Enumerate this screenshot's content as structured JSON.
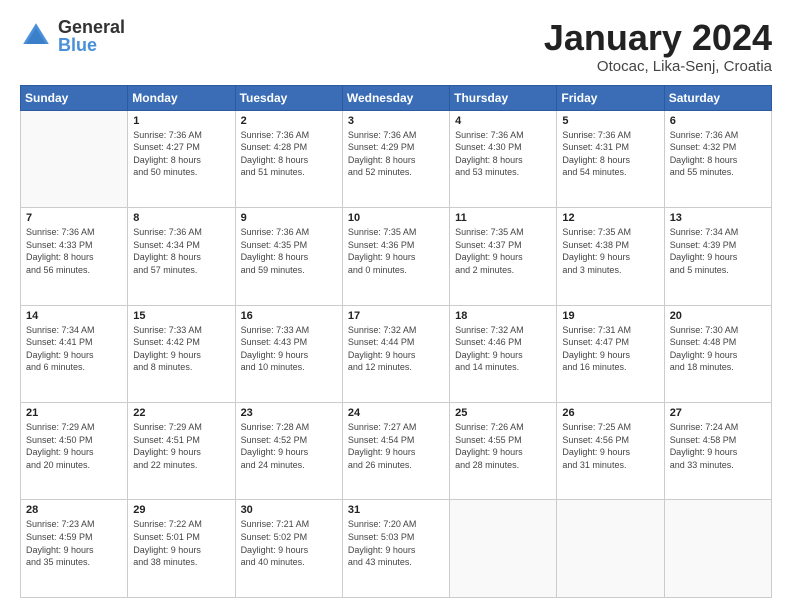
{
  "logo": {
    "general": "General",
    "blue": "Blue"
  },
  "header": {
    "month": "January 2024",
    "location": "Otocac, Lika-Senj, Croatia"
  },
  "days_of_week": [
    "Sunday",
    "Monday",
    "Tuesday",
    "Wednesday",
    "Thursday",
    "Friday",
    "Saturday"
  ],
  "weeks": [
    [
      {
        "day": "",
        "info": ""
      },
      {
        "day": "1",
        "info": "Sunrise: 7:36 AM\nSunset: 4:27 PM\nDaylight: 8 hours\nand 50 minutes."
      },
      {
        "day": "2",
        "info": "Sunrise: 7:36 AM\nSunset: 4:28 PM\nDaylight: 8 hours\nand 51 minutes."
      },
      {
        "day": "3",
        "info": "Sunrise: 7:36 AM\nSunset: 4:29 PM\nDaylight: 8 hours\nand 52 minutes."
      },
      {
        "day": "4",
        "info": "Sunrise: 7:36 AM\nSunset: 4:30 PM\nDaylight: 8 hours\nand 53 minutes."
      },
      {
        "day": "5",
        "info": "Sunrise: 7:36 AM\nSunset: 4:31 PM\nDaylight: 8 hours\nand 54 minutes."
      },
      {
        "day": "6",
        "info": "Sunrise: 7:36 AM\nSunset: 4:32 PM\nDaylight: 8 hours\nand 55 minutes."
      }
    ],
    [
      {
        "day": "7",
        "info": "Sunrise: 7:36 AM\nSunset: 4:33 PM\nDaylight: 8 hours\nand 56 minutes."
      },
      {
        "day": "8",
        "info": "Sunrise: 7:36 AM\nSunset: 4:34 PM\nDaylight: 8 hours\nand 57 minutes."
      },
      {
        "day": "9",
        "info": "Sunrise: 7:36 AM\nSunset: 4:35 PM\nDaylight: 8 hours\nand 59 minutes."
      },
      {
        "day": "10",
        "info": "Sunrise: 7:35 AM\nSunset: 4:36 PM\nDaylight: 9 hours\nand 0 minutes."
      },
      {
        "day": "11",
        "info": "Sunrise: 7:35 AM\nSunset: 4:37 PM\nDaylight: 9 hours\nand 2 minutes."
      },
      {
        "day": "12",
        "info": "Sunrise: 7:35 AM\nSunset: 4:38 PM\nDaylight: 9 hours\nand 3 minutes."
      },
      {
        "day": "13",
        "info": "Sunrise: 7:34 AM\nSunset: 4:39 PM\nDaylight: 9 hours\nand 5 minutes."
      }
    ],
    [
      {
        "day": "14",
        "info": "Sunrise: 7:34 AM\nSunset: 4:41 PM\nDaylight: 9 hours\nand 6 minutes."
      },
      {
        "day": "15",
        "info": "Sunrise: 7:33 AM\nSunset: 4:42 PM\nDaylight: 9 hours\nand 8 minutes."
      },
      {
        "day": "16",
        "info": "Sunrise: 7:33 AM\nSunset: 4:43 PM\nDaylight: 9 hours\nand 10 minutes."
      },
      {
        "day": "17",
        "info": "Sunrise: 7:32 AM\nSunset: 4:44 PM\nDaylight: 9 hours\nand 12 minutes."
      },
      {
        "day": "18",
        "info": "Sunrise: 7:32 AM\nSunset: 4:46 PM\nDaylight: 9 hours\nand 14 minutes."
      },
      {
        "day": "19",
        "info": "Sunrise: 7:31 AM\nSunset: 4:47 PM\nDaylight: 9 hours\nand 16 minutes."
      },
      {
        "day": "20",
        "info": "Sunrise: 7:30 AM\nSunset: 4:48 PM\nDaylight: 9 hours\nand 18 minutes."
      }
    ],
    [
      {
        "day": "21",
        "info": "Sunrise: 7:29 AM\nSunset: 4:50 PM\nDaylight: 9 hours\nand 20 minutes."
      },
      {
        "day": "22",
        "info": "Sunrise: 7:29 AM\nSunset: 4:51 PM\nDaylight: 9 hours\nand 22 minutes."
      },
      {
        "day": "23",
        "info": "Sunrise: 7:28 AM\nSunset: 4:52 PM\nDaylight: 9 hours\nand 24 minutes."
      },
      {
        "day": "24",
        "info": "Sunrise: 7:27 AM\nSunset: 4:54 PM\nDaylight: 9 hours\nand 26 minutes."
      },
      {
        "day": "25",
        "info": "Sunrise: 7:26 AM\nSunset: 4:55 PM\nDaylight: 9 hours\nand 28 minutes."
      },
      {
        "day": "26",
        "info": "Sunrise: 7:25 AM\nSunset: 4:56 PM\nDaylight: 9 hours\nand 31 minutes."
      },
      {
        "day": "27",
        "info": "Sunrise: 7:24 AM\nSunset: 4:58 PM\nDaylight: 9 hours\nand 33 minutes."
      }
    ],
    [
      {
        "day": "28",
        "info": "Sunrise: 7:23 AM\nSunset: 4:59 PM\nDaylight: 9 hours\nand 35 minutes."
      },
      {
        "day": "29",
        "info": "Sunrise: 7:22 AM\nSunset: 5:01 PM\nDaylight: 9 hours\nand 38 minutes."
      },
      {
        "day": "30",
        "info": "Sunrise: 7:21 AM\nSunset: 5:02 PM\nDaylight: 9 hours\nand 40 minutes."
      },
      {
        "day": "31",
        "info": "Sunrise: 7:20 AM\nSunset: 5:03 PM\nDaylight: 9 hours\nand 43 minutes."
      },
      {
        "day": "",
        "info": ""
      },
      {
        "day": "",
        "info": ""
      },
      {
        "day": "",
        "info": ""
      }
    ]
  ]
}
